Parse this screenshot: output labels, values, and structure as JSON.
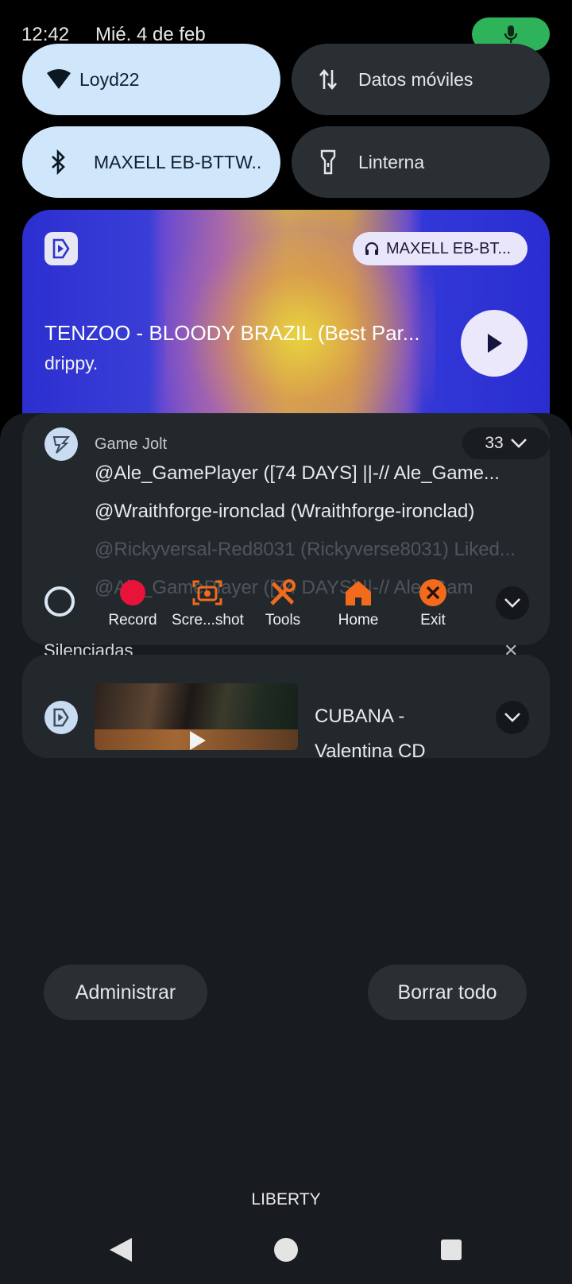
{
  "status": {
    "time": "12:42",
    "date": "Mié. 4 de feb"
  },
  "quick_tiles": [
    {
      "label": "Loyd22",
      "icon": "wifi-icon",
      "state": "on"
    },
    {
      "label": "Datos móviles",
      "icon": "mobile-data-icon",
      "state": "off"
    },
    {
      "label": "MAXELL EB-BTTW..",
      "icon": "bluetooth-icon",
      "state": "on"
    },
    {
      "label": "Linterna",
      "icon": "flashlight-icon",
      "state": "off"
    }
  ],
  "media": {
    "output_device": "MAXELL EB-BT...",
    "title": "TENZOO - BLOODY BRAZIL (Best Par...",
    "artist": "drippy."
  },
  "gamejolt": {
    "app_name": "Game Jolt",
    "count": "33",
    "lines": [
      "@Ale_GamePlayer ([74 DAYS] ||-// Ale_Game...",
      "@Wraithforge-ironclad (Wraithforge-ironclad)",
      "@Rickyversal-Red8031 (Rickyverse8031) Liked...",
      "@Ale_GamePlayer ([74 DAYS] ||-// Ale_Gam"
    ]
  },
  "overlay_tools": [
    {
      "label": "Record",
      "icon": "record-icon"
    },
    {
      "label": "Scre...shot",
      "icon": "screenshot-icon"
    },
    {
      "label": "Tools",
      "icon": "tools-icon"
    },
    {
      "label": "Home",
      "icon": "home-icon"
    },
    {
      "label": "Exit",
      "icon": "exit-icon"
    }
  ],
  "silenced": {
    "label": "Silenciadas"
  },
  "video_notification": {
    "title": "CUBANA -",
    "subtitle": "Valentina CD"
  },
  "actions": {
    "manage": "Administrar",
    "clear_all": "Borrar todo"
  },
  "carrier": "LIBERTY",
  "colors": {
    "accent_green": "#2fb35a",
    "tile_on": "#cfe6fb",
    "tool_orange": "#f26b1d",
    "record_red": "#e8133a"
  }
}
